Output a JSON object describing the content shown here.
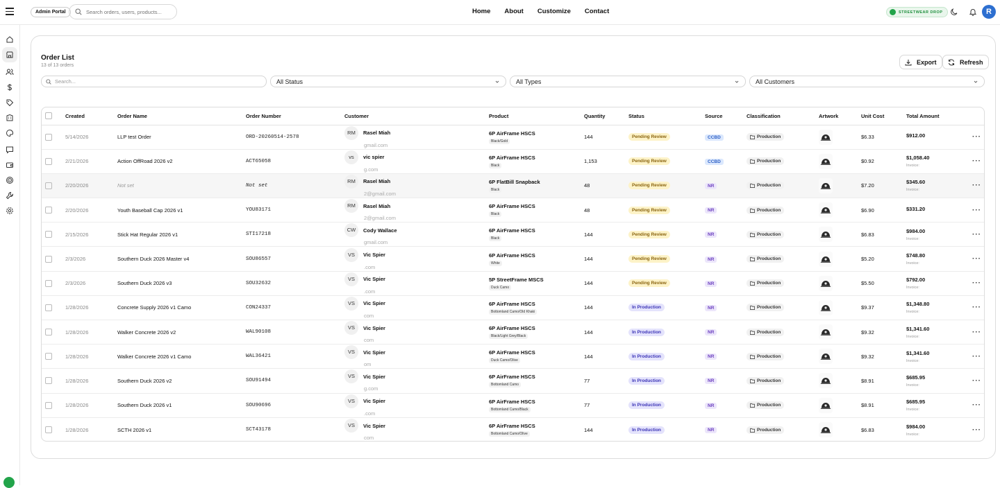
{
  "header": {
    "admin_badge": "Admin Portal",
    "search_placeholder": "Search orders, users, products...",
    "nav": [
      "Home",
      "About",
      "Customize",
      "Contact"
    ],
    "brand_label": "STREETWEAR DROP",
    "avatar_initial": "R"
  },
  "page": {
    "title": "Order List",
    "subtitle": "13 of 13 orders",
    "export_label": "Export",
    "refresh_label": "Refresh"
  },
  "filters": {
    "search_placeholder": "Search...",
    "status": "All Status",
    "types": "All Types",
    "customers": "All Customers"
  },
  "table": {
    "columns": [
      "Created",
      "Order Name",
      "Order Number",
      "Customer",
      "Product",
      "Quantity",
      "Status",
      "Source",
      "Classification",
      "Artwork",
      "Unit Cost",
      "Total Amount"
    ],
    "rows": [
      {
        "created": "5/14/2026",
        "name": "LLP test Order",
        "number": "ORD-20260514-2578",
        "initials": "RM",
        "customer": "Rasel Miah",
        "email": "gmail.com",
        "product": "6P AirFrame HSCS",
        "variant": "Black/Gold",
        "qty": "144",
        "status": "Pending Review",
        "source": "CCBD",
        "classification": "Production",
        "unit_cost": "$6.33",
        "total": "$912.00",
        "invoice": ""
      },
      {
        "created": "2/21/2026",
        "name": "Action OffRoad 2026 v2",
        "number": "ACT65058",
        "initials": "vs",
        "customer": "vic spier",
        "email": "g.com",
        "product": "6P AirFrame HSCS",
        "variant": "Black",
        "qty": "1,153",
        "status": "Pending Review",
        "source": "CCBD",
        "classification": "Production",
        "unit_cost": "$0.92",
        "total": "$1,058.40",
        "invoice": "Invoice:"
      },
      {
        "created": "2/20/2026",
        "name": "Not set",
        "number": "Not set",
        "initials": "RM",
        "customer": "Rasel Miah",
        "email": "2@gmail.com",
        "product": "6P FlatBill Snapback",
        "variant": "Black",
        "qty": "48",
        "status": "Pending Review",
        "source": "NR",
        "classification": "Production",
        "unit_cost": "$7.20",
        "total": "$345.60",
        "invoice": "Invoice:"
      },
      {
        "created": "2/20/2026",
        "name": "Youth Baseball Cap 2026 v1",
        "number": "YOU83171",
        "initials": "RM",
        "customer": "Rasel Miah",
        "email": "2@gmail.com",
        "product": "6P AirFrame HSCS",
        "variant": "Black",
        "qty": "48",
        "status": "Pending Review",
        "source": "NR",
        "classification": "Production",
        "unit_cost": "$6.90",
        "total": "$331.20",
        "invoice": ""
      },
      {
        "created": "2/15/2026",
        "name": "Stick Hat Regular 2026 v1",
        "number": "STI17218",
        "initials": "CW",
        "customer": "Cody Wallace",
        "email": "gmail.com",
        "product": "6P AirFrame HSCS",
        "variant": "Black",
        "qty": "144",
        "status": "Pending Review",
        "source": "NR",
        "classification": "Production",
        "unit_cost": "$6.83",
        "total": "$984.00",
        "invoice": "Invoice:"
      },
      {
        "created": "2/3/2026",
        "name": "Southern Duck 2026 Master v4",
        "number": "SOU86557",
        "initials": "VS",
        "customer": "Vic Spier",
        "email": ".com",
        "product": "6P AirFrame HSCS",
        "variant": "White",
        "qty": "144",
        "status": "Pending Review",
        "source": "NR",
        "classification": "Production",
        "unit_cost": "$5.20",
        "total": "$748.80",
        "invoice": "Invoice:"
      },
      {
        "created": "2/3/2026",
        "name": "Southern Duck 2026 v3",
        "number": "SOU32632",
        "initials": "VS",
        "customer": "Vic Spier",
        "email": ".com",
        "product": "5P StreetFrame MSCS",
        "variant": "Duck Camo",
        "qty": "144",
        "status": "Pending Review",
        "source": "NR",
        "classification": "Production",
        "unit_cost": "$5.50",
        "total": "$792.00",
        "invoice": "Invoice:"
      },
      {
        "created": "1/28/2026",
        "name": "Concrete Supply 2026 v1 Camo",
        "number": "CON24337",
        "initials": "VS",
        "customer": "Vic Spier",
        "email": "com",
        "product": "6P AirFrame HSCS",
        "variant": "Bottomland Camo/Old Khaki",
        "qty": "144",
        "status": "In Production",
        "source": "NR",
        "classification": "Production",
        "unit_cost": "$9.37",
        "total": "$1,348.80",
        "invoice": "Invoice:"
      },
      {
        "created": "1/28/2026",
        "name": "Walker Concrete 2026 v2",
        "number": "WAL90108",
        "initials": "VS",
        "customer": "Vic Spier",
        "email": "com",
        "product": "6P AirFrame HSCS",
        "variant": "Black/Light Grey/Black",
        "qty": "144",
        "status": "In Production",
        "source": "NR",
        "classification": "Production",
        "unit_cost": "$9.32",
        "total": "$1,341.60",
        "invoice": "Invoice:"
      },
      {
        "created": "1/28/2026",
        "name": "Walker Concrete 2026 v1 Camo",
        "number": "WAL36421",
        "initials": "VS",
        "customer": "Vic Spier",
        "email": "om",
        "product": "6P AirFrame HSCS",
        "variant": "Duck Camo/Olive",
        "qty": "144",
        "status": "In Production",
        "source": "NR",
        "classification": "Production",
        "unit_cost": "$9.32",
        "total": "$1,341.60",
        "invoice": "Invoice:"
      },
      {
        "created": "1/28/2026",
        "name": "Southern Duck 2026 v2",
        "number": "SOU91494",
        "initials": "VS",
        "customer": "Vic Spier",
        "email": "g.com",
        "product": "6P AirFrame HSCS",
        "variant": "Bottomland Camo",
        "qty": "77",
        "status": "In Production",
        "source": "NR",
        "classification": "Production",
        "unit_cost": "$8.91",
        "total": "$685.95",
        "invoice": "Invoice:"
      },
      {
        "created": "1/28/2026",
        "name": "Southern Duck 2026 v1",
        "number": "SOU90696",
        "initials": "VS",
        "customer": "Vic Spier",
        "email": ".com",
        "product": "6P AirFrame HSCS",
        "variant": "Bottomland Camo/Black",
        "qty": "77",
        "status": "In Production",
        "source": "NR",
        "classification": "Production",
        "unit_cost": "$8.91",
        "total": "$685.95",
        "invoice": "Invoice:"
      },
      {
        "created": "1/28/2026",
        "name": "SCTH 2026 v1",
        "number": "SCT43178",
        "initials": "VS",
        "customer": "Vic Spier",
        "email": "com",
        "product": "6P AirFrame HSCS",
        "variant": "Bottomland Camo/Olive",
        "qty": "144",
        "status": "In Production",
        "source": "NR",
        "classification": "Production",
        "unit_cost": "$6.83",
        "total": "$984.00",
        "invoice": "Invoice:"
      }
    ]
  },
  "colors": {
    "brand_green": "#22a44a",
    "pending": "#fdf3c8",
    "in_production": "#e4e3fc",
    "avatar_blue": "#2d6fd0"
  }
}
